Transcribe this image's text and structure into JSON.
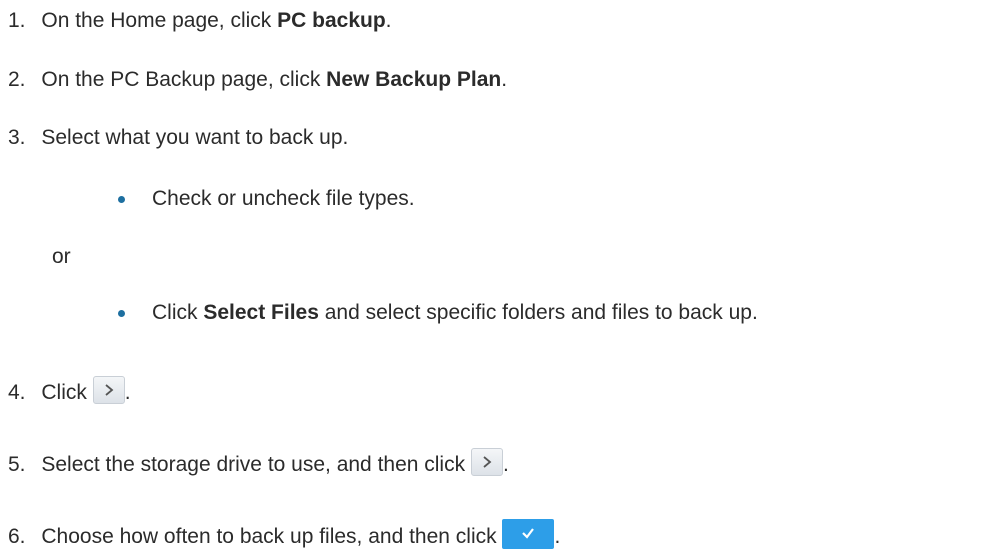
{
  "steps": [
    {
      "num": "1.",
      "pre": "On the Home page, click ",
      "bold": "PC backup",
      "post": "."
    },
    {
      "num": "2.",
      "pre": "On the PC Backup page, click ",
      "bold": "New Backup Plan",
      "post": "."
    },
    {
      "num": "3.",
      "text": "Select what you want to back up."
    },
    {
      "bullet1": "Check or uncheck file types."
    },
    {
      "or": "or"
    },
    {
      "bullet2_pre": "Click ",
      "bullet2_bold": "Select Files",
      "bullet2_post": " and select specific folders and files to back up."
    },
    {
      "num": "4.",
      "pre": "Click ",
      "post": "."
    },
    {
      "num": "5.",
      "pre": "Select the storage drive to use, and then click ",
      "post": "."
    },
    {
      "num": "6.",
      "pre": "Choose how often to back up files, and then click ",
      "post": "."
    }
  ],
  "icons": {
    "next": "chevron-right-icon",
    "confirm": "checkmark-icon"
  },
  "colors": {
    "text": "#2b2b2b",
    "bullet": "#1d6fa0",
    "confirm_button": "#2d9ee8"
  }
}
